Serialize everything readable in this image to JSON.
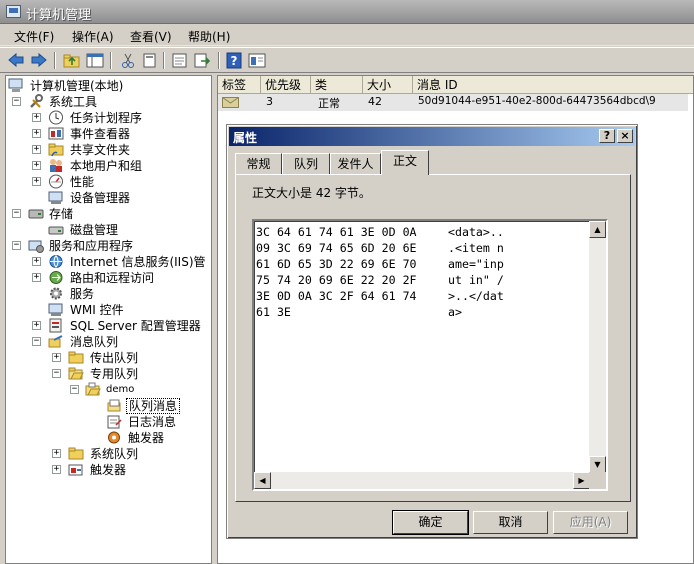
{
  "window": {
    "title": "计算机管理"
  },
  "menu": [
    "文件(F)",
    "操作(A)",
    "查看(V)",
    "帮助(H)"
  ],
  "toolbar": {
    "icons": [
      "back-icon",
      "forward-icon",
      "up-folder-icon",
      "show-hide-tree-icon",
      "cut-icon",
      "copy-icon",
      "properties-icon",
      "export-icon",
      "help-icon",
      "view-icon"
    ]
  },
  "tree": {
    "root": "计算机管理(本地)",
    "system_tools": "系统工具",
    "task_scheduler": "任务计划程序",
    "event_viewer": "事件查看器",
    "shared_folders": "共享文件夹",
    "local_users": "本地用户和组",
    "performance": "性能",
    "device_manager": "设备管理器",
    "storage": "存储",
    "disk_management": "磁盘管理",
    "services_apps": "服务和应用程序",
    "iis": "Internet 信息服务(IIS)管",
    "routing": "路由和远程访问",
    "services": "服务",
    "wmi": "WMI 控件",
    "sql": "SQL Server 配置管理器",
    "msmq": "消息队列",
    "outgoing": "传出队列",
    "private": "专用队列",
    "demo": "demo",
    "queue_messages": "队列消息",
    "journal_messages": "日志消息",
    "triggers_q": "触发器",
    "system_queues": "系统队列",
    "triggers": "触发器"
  },
  "list": {
    "columns": [
      "标签",
      "优先级",
      "类",
      "大小",
      "消息 ID"
    ],
    "rows": [
      {
        "label": "",
        "priority": "3",
        "class": "正常",
        "size": "42",
        "id": "50d91044-e951-40e2-800d-64473564dbcd\\9"
      }
    ]
  },
  "dialog": {
    "title": "属性",
    "help_button": "?",
    "close_button": "×",
    "tabs": [
      "常规",
      "队列",
      "发件人",
      "正文"
    ],
    "active_tab": "正文",
    "size_text": "正文大小是 42 字节。",
    "hex_lines": [
      {
        "hex": "3C 64 61 74 61 3E 0D 0A",
        "text": "<data>.."
      },
      {
        "hex": "09 3C 69 74 65 6D 20 6E",
        "text": ".<item n"
      },
      {
        "hex": "61 6D 65 3D 22 69 6E 70",
        "text": "ame=\"inp"
      },
      {
        "hex": "75 74 20 69 6E 22 20 2F",
        "text": "ut in\" /"
      },
      {
        "hex": "3E 0D 0A 3C 2F 64 61 74",
        "text": ">..</dat"
      },
      {
        "hex": "61 3E",
        "text": "a>"
      }
    ],
    "buttons": {
      "ok": "确定",
      "cancel": "取消",
      "apply": "应用(A)"
    }
  }
}
